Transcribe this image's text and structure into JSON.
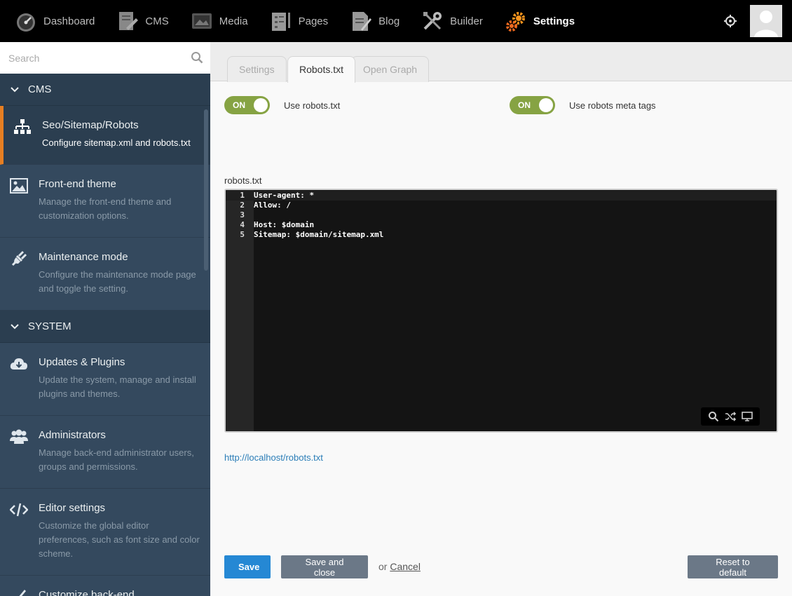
{
  "topnav": {
    "items": [
      {
        "label": "Dashboard",
        "icon": "dashboard-icon"
      },
      {
        "label": "CMS",
        "icon": "cms-icon"
      },
      {
        "label": "Media",
        "icon": "media-icon"
      },
      {
        "label": "Pages",
        "icon": "pages-icon"
      },
      {
        "label": "Blog",
        "icon": "blog-icon"
      },
      {
        "label": "Builder",
        "icon": "builder-icon"
      },
      {
        "label": "Settings",
        "icon": "settings-icon",
        "active": true
      }
    ],
    "accent": "#f16a1f"
  },
  "sidebar": {
    "search_placeholder": "Search",
    "groups": [
      {
        "label": "CMS",
        "items": [
          {
            "title": "Seo/Sitemap/Robots",
            "desc": "Configure sitemap.xml and robots.txt",
            "icon": "sitemap-icon",
            "active": true
          },
          {
            "title": "Front-end theme",
            "desc": "Manage the front-end theme and customization options.",
            "icon": "image-icon"
          },
          {
            "title": "Maintenance mode",
            "desc": "Configure the maintenance mode page and toggle the setting.",
            "icon": "plug-icon"
          }
        ]
      },
      {
        "label": "SYSTEM",
        "items": [
          {
            "title": "Updates & Plugins",
            "desc": "Update the system, manage and install plugins and themes.",
            "icon": "cloud-download-icon"
          },
          {
            "title": "Administrators",
            "desc": "Manage back-end administrator users, groups and permissions.",
            "icon": "users-icon"
          },
          {
            "title": "Editor settings",
            "desc": "Customize the global editor preferences, such as font size and color scheme.",
            "icon": "code-icon"
          },
          {
            "title": "Customize back-end",
            "desc": "",
            "icon": "brush-icon"
          }
        ]
      }
    ],
    "active_accent": "#e67e22"
  },
  "tabs": [
    {
      "label": "Settings"
    },
    {
      "label": "Robots.txt",
      "active": true
    },
    {
      "label": "Open Graph"
    }
  ],
  "toggles": [
    {
      "state": "ON",
      "label": "Use robots.txt"
    },
    {
      "state": "ON",
      "label": "Use robots meta tags"
    }
  ],
  "editor": {
    "label": "robots.txt",
    "lines": [
      {
        "n": "1",
        "text": "User-agent: *"
      },
      {
        "n": "2",
        "text": "Allow: /"
      },
      {
        "n": "3",
        "text": ""
      },
      {
        "n": "4",
        "text": "Host: $domain"
      },
      {
        "n": "5",
        "text": "Sitemap: $domain/sitemap.xml"
      }
    ]
  },
  "robots_url": "http://localhost/robots.txt",
  "actions": {
    "save": "Save",
    "save_close": "Save and close",
    "or": "or",
    "cancel": "Cancel",
    "reset": "Reset to default"
  }
}
